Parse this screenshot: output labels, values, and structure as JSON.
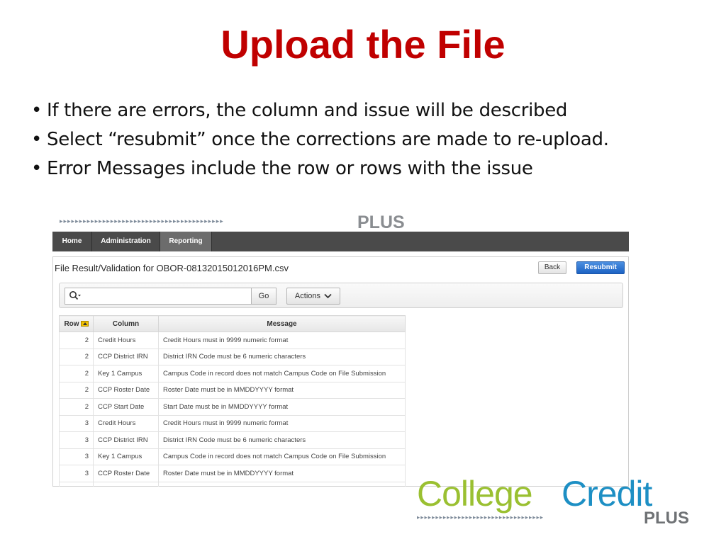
{
  "slide": {
    "title": "Upload the File",
    "bullets": [
      "If there are errors, the column and issue will be described",
      "Select “resubmit” once the corrections are made to re-upload.",
      "Error Messages include the row or rows with the issue"
    ]
  },
  "brand": {
    "top_arrows": "▸▸▸▸▸▸▸▸▸▸▸▸▸▸▸▸▸▸▸▸▸▸▸▸▸▸▸▸▸▸▸▸▸▸▸▸▸▸▸▸▸▸",
    "top_plus": "PLUS"
  },
  "nav": {
    "tabs": [
      {
        "label": "Home",
        "active": false
      },
      {
        "label": "Administration",
        "active": false
      },
      {
        "label": "Reporting",
        "active": true
      }
    ]
  },
  "panel": {
    "title": "File Result/Validation for OBOR-08132015012016PM.csv",
    "back_label": "Back",
    "resubmit_label": "Resubmit"
  },
  "search": {
    "value": "",
    "go_label": "Go",
    "actions_label": "Actions"
  },
  "table": {
    "headers": [
      "Row",
      "Column",
      "Message"
    ],
    "rows": [
      [
        "2",
        "Credit Hours",
        "Credit Hours must in 9999 numeric format"
      ],
      [
        "2",
        "CCP District IRN",
        "District IRN Code must be 6 numeric characters"
      ],
      [
        "2",
        "Key 1 Campus",
        "Campus Code in record does not match Campus Code on File Submission"
      ],
      [
        "2",
        "CCP Roster Date",
        "Roster Date must be in MMDDYYYY format"
      ],
      [
        "2",
        "CCP Start Date",
        "Start Date must be in MMDDYYYY format"
      ],
      [
        "3",
        "Credit Hours",
        "Credit Hours must in 9999 numeric format"
      ],
      [
        "3",
        "CCP District IRN",
        "District IRN Code must be 6 numeric characters"
      ],
      [
        "3",
        "Key 1 Campus",
        "Campus Code in record does not match Campus Code on File Submission"
      ],
      [
        "3",
        "CCP Roster Date",
        "Roster Date must be in MMDDYYYY format"
      ],
      [
        "",
        "",
        ""
      ]
    ]
  },
  "logo": {
    "college": "College",
    "credit": "Credit",
    "plus": "PLUS",
    "arrows": "▸▸▸▸▸▸▸▸▸▸▸▸▸▸▸▸▸▸▸▸▸▸▸▸▸▸▸▸▸▸▸▸▸▸"
  },
  "colors": {
    "title": "#c00000",
    "navbar": "#4a4a4a",
    "resubmit": "#1c62c4",
    "logo_green": "#9ac031",
    "logo_blue": "#1d8fc4"
  }
}
